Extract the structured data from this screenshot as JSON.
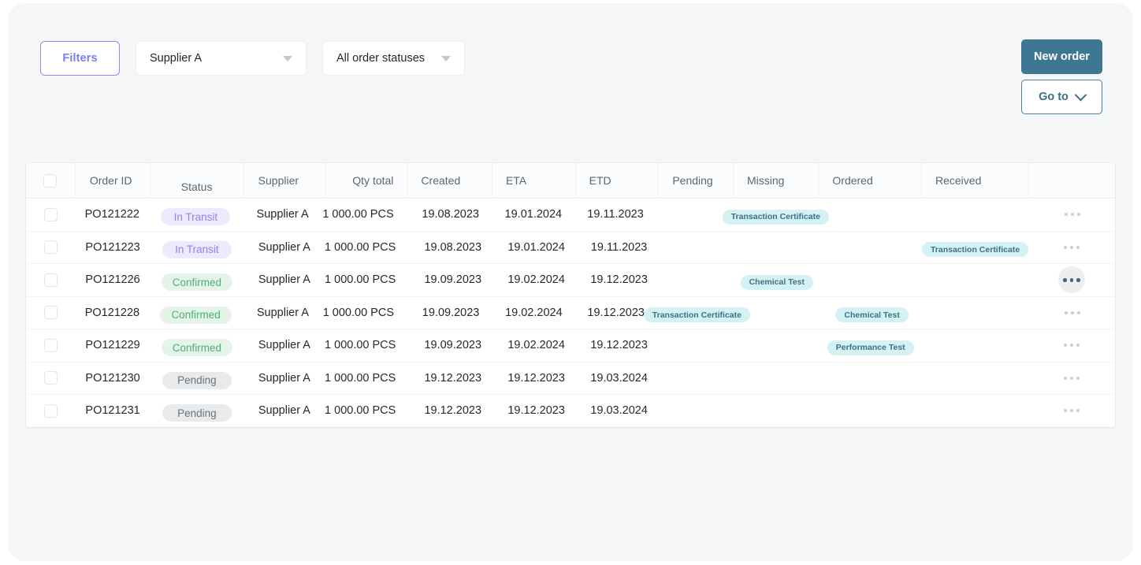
{
  "toolbar": {
    "filters_label": "Filters",
    "supplier_select": {
      "value": "Supplier A"
    },
    "status_select": {
      "value": "All order statuses"
    },
    "new_order_label": "New order",
    "goto_label": "Go to"
  },
  "accents": {
    "filters_purple": "#7b7ef0",
    "primary_teal": "#3e7792",
    "chip_bg": "#d4f1f4",
    "chip_text": "#3d7185",
    "badge_transit_bg": "#eceafc",
    "badge_transit_text": "#8b86ea",
    "badge_confirmed_bg": "#e4f4e9",
    "badge_confirmed_text": "#4cb072",
    "badge_pending_bg": "#e8eaec",
    "badge_pending_text": "#6a737e",
    "page_bg": "#f5f6f8"
  },
  "table": {
    "columns": [
      {
        "key": "select",
        "label": ""
      },
      {
        "key": "order_id",
        "label": "Order ID"
      },
      {
        "key": "status",
        "label": "Status"
      },
      {
        "key": "supplier",
        "label": "Supplier"
      },
      {
        "key": "qty",
        "label": "Qty total"
      },
      {
        "key": "created",
        "label": "Created"
      },
      {
        "key": "eta",
        "label": "ETA"
      },
      {
        "key": "etd",
        "label": "ETD"
      },
      {
        "key": "pending",
        "label": "Pending"
      },
      {
        "key": "missing",
        "label": "Missing"
      },
      {
        "key": "ordered",
        "label": "Ordered"
      },
      {
        "key": "received",
        "label": "Received"
      },
      {
        "key": "actions",
        "label": ""
      }
    ],
    "rows": [
      {
        "order_id": "PO121222",
        "status": "In Transit",
        "status_kind": "transit",
        "supplier": "Supplier A",
        "qty": "1 000.00 PCS",
        "created": "19.08.2023",
        "eta": "19.01.2024",
        "etd": "19.11.2023",
        "pending": "",
        "missing": "Transaction Certificate",
        "ordered": "",
        "received": "",
        "actions_hovered": false
      },
      {
        "order_id": "PO121223",
        "status": "In Transit",
        "status_kind": "transit",
        "supplier": "Supplier A",
        "qty": "1 000.00 PCS",
        "created": "19.08.2023",
        "eta": "19.01.2024",
        "etd": "19.11.2023",
        "pending": "",
        "missing": "",
        "ordered": "",
        "received": "Transaction Certificate",
        "actions_hovered": false
      },
      {
        "order_id": "PO121226",
        "status": "Confirmed",
        "status_kind": "confirmed",
        "supplier": "Supplier A",
        "qty": "1 000.00 PCS",
        "created": "19.09.2023",
        "eta": "19.02.2024",
        "etd": "19.12.2023",
        "pending": "",
        "missing": "Chemical Test",
        "ordered": "",
        "received": "",
        "actions_hovered": true
      },
      {
        "order_id": "PO121228",
        "status": "Confirmed",
        "status_kind": "confirmed",
        "supplier": "Supplier A",
        "qty": "1 000.00 PCS",
        "created": "19.09.2023",
        "eta": "19.02.2024",
        "etd": "19.12.2023",
        "pending": "Transaction Certificate",
        "missing": "",
        "ordered": "Chemical Test",
        "received": "",
        "actions_hovered": false
      },
      {
        "order_id": "PO121229",
        "status": "Confirmed",
        "status_kind": "confirmed",
        "supplier": "Supplier A",
        "qty": "1 000.00 PCS",
        "created": "19.09.2023",
        "eta": "19.02.2024",
        "etd": "19.12.2023",
        "pending": "",
        "missing": "",
        "ordered": "Performance Test",
        "received": "",
        "actions_hovered": false
      },
      {
        "order_id": "PO121230",
        "status": "Pending",
        "status_kind": "pending",
        "supplier": "Supplier A",
        "qty": "1 000.00 PCS",
        "created": "19.12.2023",
        "eta": "19.12.2023",
        "etd": "19.03.2024",
        "pending": "",
        "missing": "",
        "ordered": "",
        "received": "",
        "actions_hovered": false
      },
      {
        "order_id": "PO121231",
        "status": "Pending",
        "status_kind": "pending",
        "supplier": "Supplier A",
        "qty": "1 000.00 PCS",
        "created": "19.12.2023",
        "eta": "19.12.2023",
        "etd": "19.03.2024",
        "pending": "",
        "missing": "",
        "ordered": "",
        "received": "",
        "actions_hovered": false
      }
    ]
  }
}
